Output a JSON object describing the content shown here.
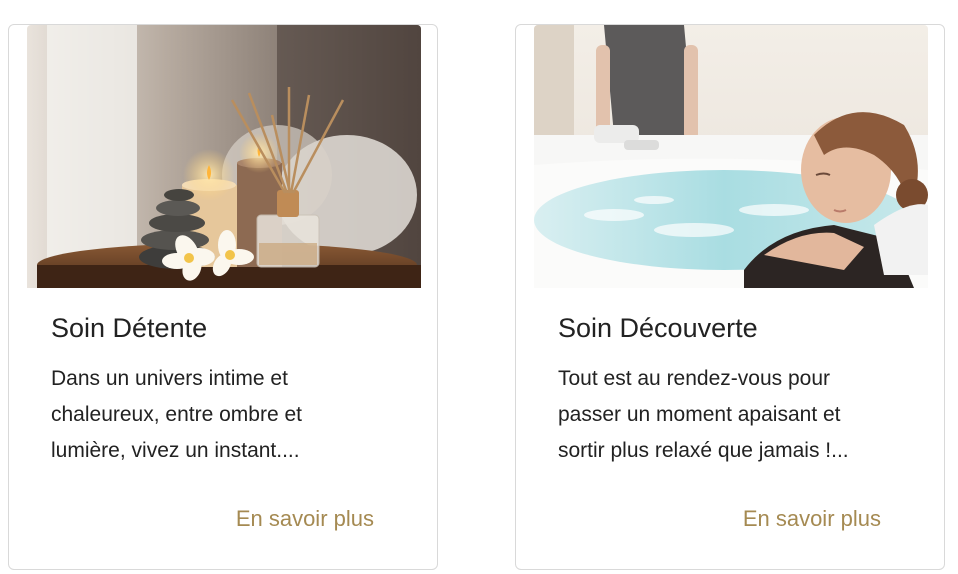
{
  "cards": [
    {
      "title": "Soin Détente",
      "text": "Dans un univers intime et chaleureux, entre ombre et lumière, vivez un instant....",
      "link": "En savoir plus",
      "image": "spa-candles-stones-reed-diffuser-photo"
    },
    {
      "title": "Soin Découverte",
      "text": "Tout est au rendez-vous pour passer un moment apaisant et sortir plus relaxé que jamais !...",
      "link": "En savoir plus",
      "image": "woman-relaxing-in-jacuzzi-bath-photo"
    }
  ],
  "colors": {
    "link": "#a58a52",
    "border": "#d9d9d9",
    "text": "#222222"
  }
}
